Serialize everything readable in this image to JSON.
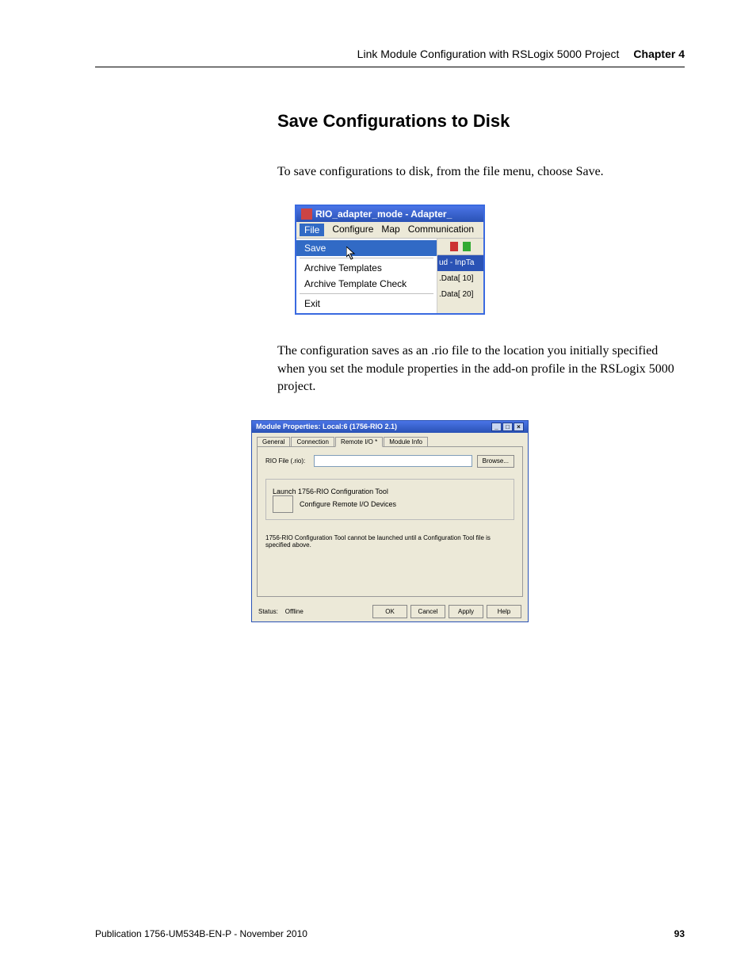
{
  "header": {
    "title": "Link Module Configuration with RSLogix 5000 Project",
    "chapter": "Chapter 4"
  },
  "section": {
    "title": "Save Configurations to Disk"
  },
  "para1": "To save configurations to disk, from the file menu, choose Save.",
  "para2": "The configuration saves as an .rio file to the location you initially specified when you set the module properties in the add-on profile in the RSLogix 5000 project.",
  "fig1": {
    "window_title": "RIO_adapter_mode - Adapter_",
    "menubar": {
      "file": "File",
      "configure": "Configure",
      "map": "Map",
      "communication": "Communication"
    },
    "menu": {
      "save": "Save",
      "archive_templates": "Archive Templates",
      "archive_template_check": "Archive Template Check",
      "exit": "Exit"
    },
    "side": {
      "t0": "ud - InpTa",
      "t1": ".Data[ 10]",
      "t2": ".Data[ 20]"
    }
  },
  "fig2": {
    "window_title": "Module Properties: Local:6 (1756-RIO 2.1)",
    "tabs": {
      "general": "General",
      "connection": "Connection",
      "remote_io": "Remote I/O *",
      "module_info": "Module Info"
    },
    "rio_label": "RIO File (.rio):",
    "rio_value": "",
    "browse": "Browse...",
    "group_legend": "Launch 1756-RIO Configuration Tool",
    "group_text": "Configure Remote I/O Devices",
    "note": "1756-RIO Configuration Tool cannot be launched until a Configuration Tool file is specified above.",
    "status_label": "Status:",
    "status_value": "Offline",
    "buttons": {
      "ok": "OK",
      "cancel": "Cancel",
      "apply": "Apply",
      "help": "Help"
    }
  },
  "footer": {
    "pub": "Publication 1756-UM534B-EN-P - November 2010",
    "page": "93"
  }
}
